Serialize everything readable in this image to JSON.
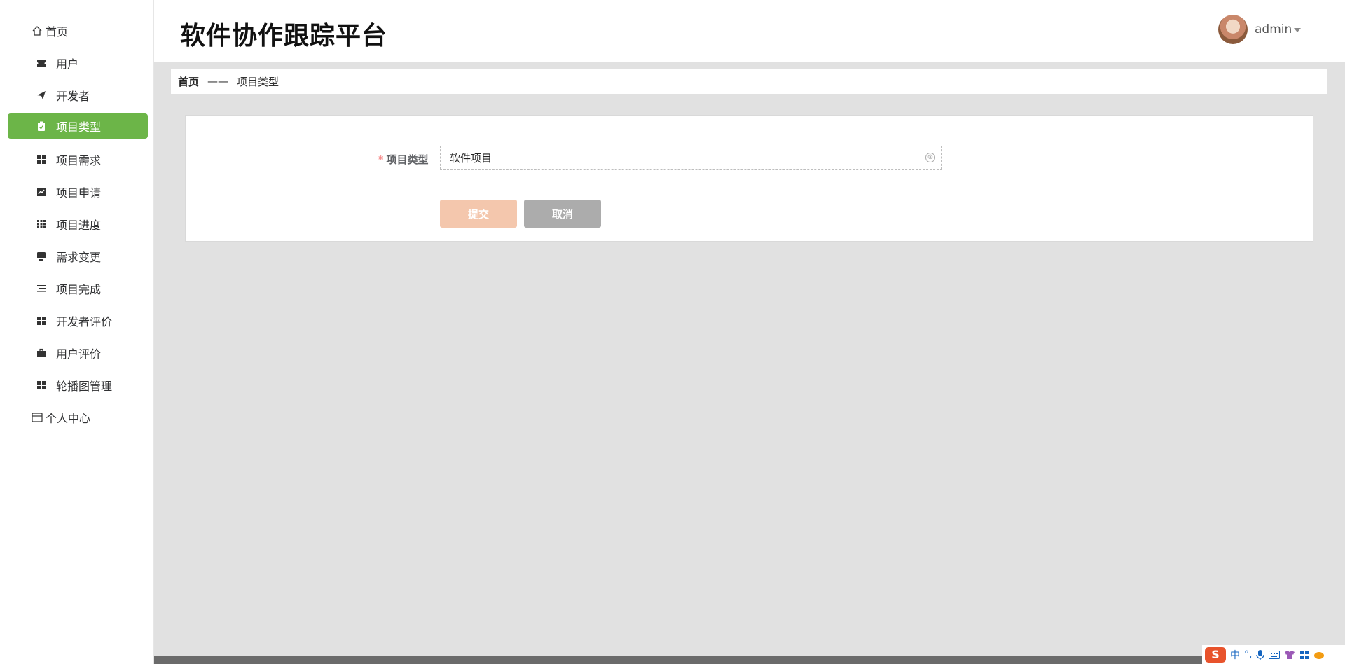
{
  "app": {
    "title": "软件协作跟踪平台",
    "user": "admin"
  },
  "sidebar": {
    "items": [
      {
        "label": "首页",
        "icon": "home-icon"
      },
      {
        "label": "用户",
        "icon": "ticket-icon"
      },
      {
        "label": "开发者",
        "icon": "send-icon"
      },
      {
        "label": "项目类型",
        "icon": "clipboard-icon",
        "active": true
      },
      {
        "label": "项目需求",
        "icon": "grid-icon"
      },
      {
        "label": "项目申请",
        "icon": "chart-icon"
      },
      {
        "label": "项目进度",
        "icon": "apps-icon"
      },
      {
        "label": "需求变更",
        "icon": "monitor-icon"
      },
      {
        "label": "项目完成",
        "icon": "list-icon"
      },
      {
        "label": "开发者评价",
        "icon": "grid-icon"
      },
      {
        "label": "用户评价",
        "icon": "briefcase-icon"
      },
      {
        "label": "轮播图管理",
        "icon": "grid-icon"
      },
      {
        "label": "个人中心",
        "icon": "card-icon"
      }
    ]
  },
  "breadcrumb": {
    "home": "首页",
    "separator": "——",
    "current": "项目类型"
  },
  "form": {
    "required_mark": "*",
    "field_label": "项目类型",
    "field_value": "软件项目",
    "clear_icon": "⊗",
    "submit_label": "提交",
    "cancel_label": "取消"
  },
  "ime": {
    "logo": "S",
    "mode": "中",
    "punct": "°,"
  },
  "colors": {
    "accent": "#6cb548",
    "submit": "#f4c7ad",
    "cancel": "#acacac",
    "background": "#e1e1e1"
  }
}
